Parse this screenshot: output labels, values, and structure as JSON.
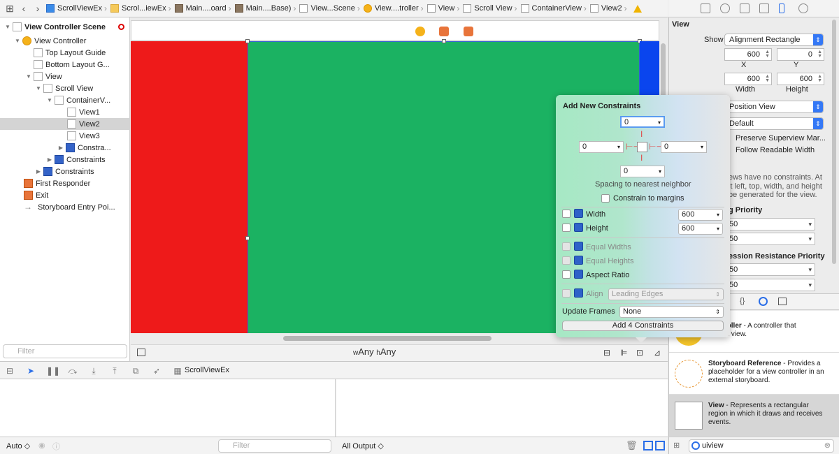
{
  "breadcrumbs": [
    "ScrollViewEx",
    "Scrol...iewEx",
    "Main....oard",
    "Main....Base)",
    "View...Scene",
    "View....troller",
    "View",
    "Scroll View",
    "ContainerView",
    "View2"
  ],
  "outline": {
    "items": [
      {
        "label": "View Controller Scene"
      },
      {
        "label": "View Controller"
      },
      {
        "label": "Top Layout Guide"
      },
      {
        "label": "Bottom Layout G..."
      },
      {
        "label": "View"
      },
      {
        "label": "Scroll View"
      },
      {
        "label": "ContainerV..."
      },
      {
        "label": "View1"
      },
      {
        "label": "View2"
      },
      {
        "label": "View3"
      },
      {
        "label": "Constra..."
      },
      {
        "label": "Constraints"
      },
      {
        "label": "Constraints"
      },
      {
        "label": "First Responder"
      },
      {
        "label": "Exit"
      },
      {
        "label": "Storyboard Entry Poi..."
      }
    ],
    "filter_placeholder": "Filter"
  },
  "canvas": {
    "size_class_w": "Any",
    "size_class_h": "Any",
    "w_prefix": "w",
    "h_prefix": "h"
  },
  "debug": {
    "target": "ScrollViewEx",
    "auto": "Auto",
    "filter_placeholder": "Filter",
    "output": "All Output"
  },
  "inspector": {
    "section": "View",
    "show_label": "Show",
    "show_value": "Alignment Rectangle",
    "x": "600",
    "y": "0",
    "x_label": "X",
    "y_label": "Y",
    "width": "600",
    "height": "600",
    "width_label": "Width",
    "height_label": "Height",
    "arrange": "Position View",
    "default": "Default",
    "preserve": "Preserve Superview Mar...",
    "follow": "Follow Readable Width",
    "note1": "ews have no constraints. At",
    "note2": "it left, top, width, and height",
    "note3": "be generated for the view.",
    "hugging": "g Priority",
    "h1": "50",
    "h2": "50",
    "compression": "ession Resistance Priority",
    "c1": "50",
    "c2": "50"
  },
  "library": [
    {
      "name": "Controller",
      "desc1": " - A controller that",
      "desc2": "ages a view."
    },
    {
      "name": "Storyboard Reference",
      "desc1": " - Provides a",
      "desc2": "placeholder for a view controller in an",
      "desc3": "external storyboard."
    },
    {
      "name": "View",
      "desc1": " - Represents a rectangular",
      "desc2": "region in which it draws and receives",
      "desc3": "events."
    }
  ],
  "library_search": "uiview",
  "popover": {
    "title": "Add New Constraints",
    "top": "0",
    "left": "0",
    "right": "0",
    "bottom": "0",
    "spacing_label": "Spacing to nearest neighbor",
    "constrain_margins": "Constrain to margins",
    "width_label": "Width",
    "width_value": "600",
    "height_label": "Height",
    "height_value": "600",
    "equal_widths": "Equal Widths",
    "equal_heights": "Equal Heights",
    "aspect_ratio": "Aspect Ratio",
    "align_label": "Align",
    "align_value": "Leading Edges",
    "update_frames_label": "Update Frames",
    "update_frames_value": "None",
    "add_button": "Add 4 Constraints"
  },
  "colors": {
    "red": "#ee1a1a",
    "green": "#1bb262",
    "blue": "#0a45ee",
    "accent": "#3478f6"
  }
}
